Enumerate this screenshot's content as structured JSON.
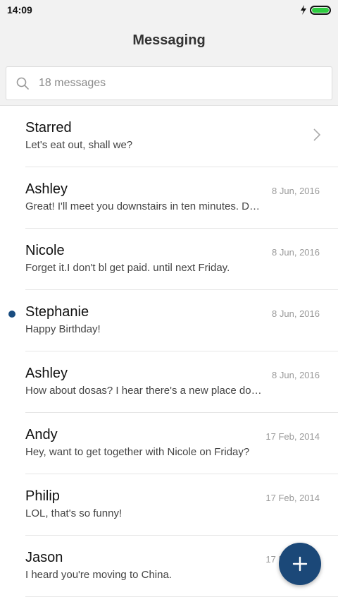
{
  "status_bar": {
    "time": "14:09",
    "battery_level": 1.0,
    "charging": true
  },
  "header": {
    "title": "Messaging"
  },
  "search": {
    "placeholder": "18 messages"
  },
  "conversations": [
    {
      "name": "Starred",
      "preview": "Let's eat out, shall we?",
      "date": "",
      "chevron": true,
      "unread": false
    },
    {
      "name": "Ashley",
      "preview": "Great! I'll meet you downstairs in ten minutes. D…",
      "date": "8 Jun, 2016",
      "unread": false
    },
    {
      "name": "Nicole",
      "preview": "Forget it.I don't bl get paid. until next Friday.",
      "date": "8 Jun, 2016",
      "unread": false
    },
    {
      "name": "Stephanie",
      "preview": "Happy Birthday!",
      "date": "8 Jun, 2016",
      "unread": true
    },
    {
      "name": "Ashley",
      "preview": "How about dosas? I hear there's a new place do…",
      "date": "8 Jun, 2016",
      "unread": false
    },
    {
      "name": "Andy",
      "preview": "Hey, want to get together with Nicole on Friday?",
      "date": "17 Feb, 2014",
      "unread": false
    },
    {
      "name": "Philip",
      "preview": "LOL, that's so funny!",
      "date": "17 Feb, 2014",
      "unread": false
    },
    {
      "name": "Jason",
      "preview": "I heard you're moving to China.",
      "date": "17 Feb, 2014",
      "unread": false
    }
  ],
  "colors": {
    "accent": "#1b4878",
    "unread_dot": "#1a4d80",
    "battery": "#2ecc40"
  },
  "icons": {
    "search": "search-icon",
    "compose": "plus-icon",
    "chevron": "chevron-right-icon"
  }
}
